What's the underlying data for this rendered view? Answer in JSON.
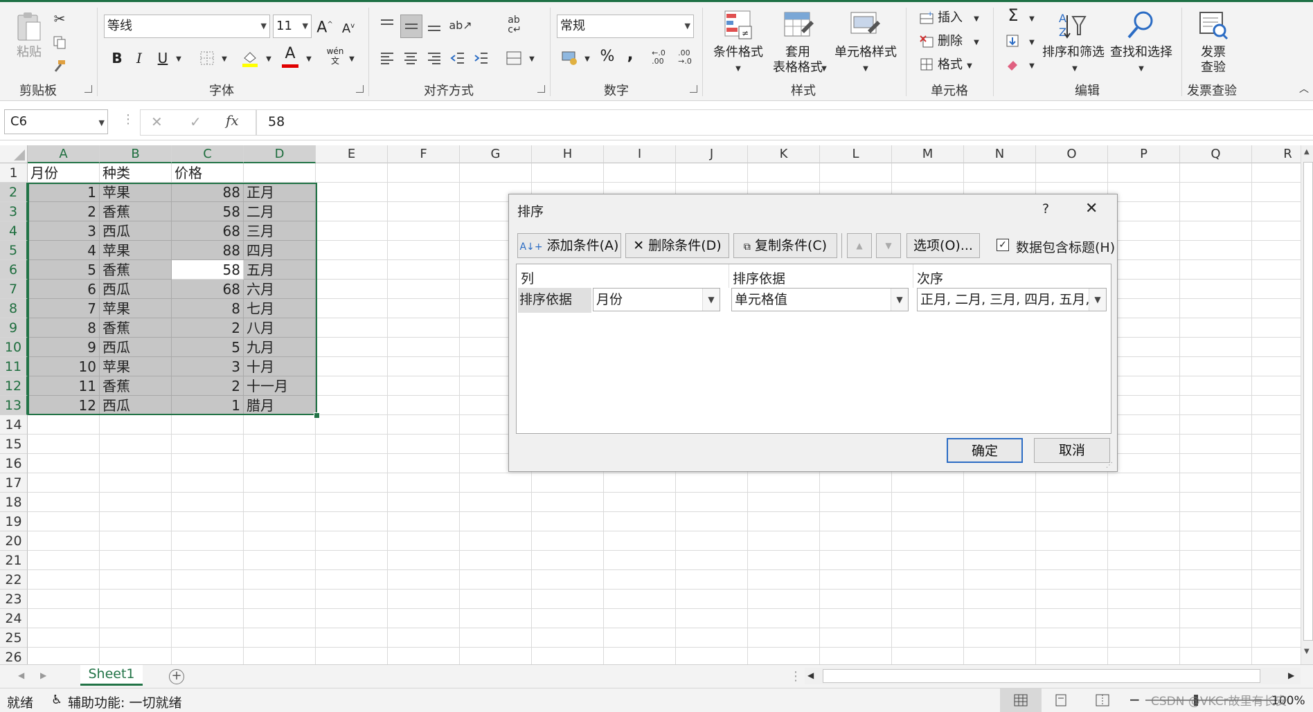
{
  "ribbon": {
    "clipboard": {
      "paste": "粘贴",
      "group": "剪贴板"
    },
    "font": {
      "name": "等线",
      "size": "11",
      "group": "字体",
      "grow": "A",
      "shrink": "A",
      "bold": "B",
      "italic": "I",
      "underline": "U",
      "color_letter": "A",
      "pinyin": "wén"
    },
    "alignment": {
      "group": "对齐方式"
    },
    "number": {
      "format": "常规",
      "group": "数字",
      "percent": "%",
      "comma": ","
    },
    "styles": {
      "conditional": "条件格式",
      "table_line1": "套用",
      "table_line2": "表格格式",
      "cell_styles": "单元格样式",
      "group": "样式"
    },
    "cells": {
      "insert": "插入",
      "delete": "删除",
      "format": "格式",
      "group": "单元格"
    },
    "editing": {
      "sort_filter": "排序和筛选",
      "find_select": "查找和选择",
      "group": "编辑",
      "sigma": "Σ"
    },
    "invoice": {
      "line1": "发票",
      "line2": "查验",
      "group": "发票查验"
    }
  },
  "formula_bar": {
    "name_box": "C6",
    "cancel": "✕",
    "enter": "✓",
    "fx": "fx",
    "value": "58"
  },
  "grid": {
    "columns": [
      "A",
      "B",
      "C",
      "D",
      "E",
      "F",
      "G",
      "H",
      "I",
      "J",
      "K",
      "L",
      "M",
      "N",
      "O",
      "P",
      "Q",
      "R"
    ],
    "rows": [
      "1",
      "2",
      "3",
      "4",
      "5",
      "6",
      "7",
      "8",
      "9",
      "10",
      "11",
      "12",
      "13",
      "14",
      "15",
      "16",
      "17",
      "18",
      "19",
      "20",
      "21",
      "22",
      "23",
      "24",
      "25",
      "26"
    ],
    "header": [
      "月份",
      "种类",
      "价格",
      ""
    ],
    "data": [
      [
        "1",
        "苹果",
        "88",
        "正月"
      ],
      [
        "2",
        "香蕉",
        "58",
        "二月"
      ],
      [
        "3",
        "西瓜",
        "68",
        "三月"
      ],
      [
        "4",
        "苹果",
        "88",
        "四月"
      ],
      [
        "5",
        "香蕉",
        "58",
        "五月"
      ],
      [
        "6",
        "西瓜",
        "68",
        "六月"
      ],
      [
        "7",
        "苹果",
        "8",
        "七月"
      ],
      [
        "8",
        "香蕉",
        "2",
        "八月"
      ],
      [
        "9",
        "西瓜",
        "5",
        "九月"
      ],
      [
        "10",
        "苹果",
        "3",
        "十月"
      ],
      [
        "11",
        "香蕉",
        "2",
        "十一月"
      ],
      [
        "12",
        "西瓜",
        "1",
        "腊月"
      ]
    ]
  },
  "dialog": {
    "title": "排序",
    "help": "?",
    "close": "✕",
    "add": "添加条件(A)",
    "delete": "删除条件(D)",
    "copy": "复制条件(C)",
    "options": "选项(O)...",
    "header_checkbox": "数据包含标题(H)",
    "col_column": "列",
    "col_sorton": "排序依据",
    "col_order": "次序",
    "row_label": "排序依据",
    "column_value": "月份",
    "sorton_value": "单元格值",
    "order_value": "正月, 二月, 三月, 四月, 五月, 六",
    "ok": "确定",
    "cancel": "取消"
  },
  "sheets": {
    "active": "Sheet1",
    "add": "+"
  },
  "status": {
    "ready": "就绪",
    "accessibility": "辅助功能: 一切就绪",
    "zoom": "100%",
    "watermark": "CSDN @VKCr故里有长安"
  }
}
